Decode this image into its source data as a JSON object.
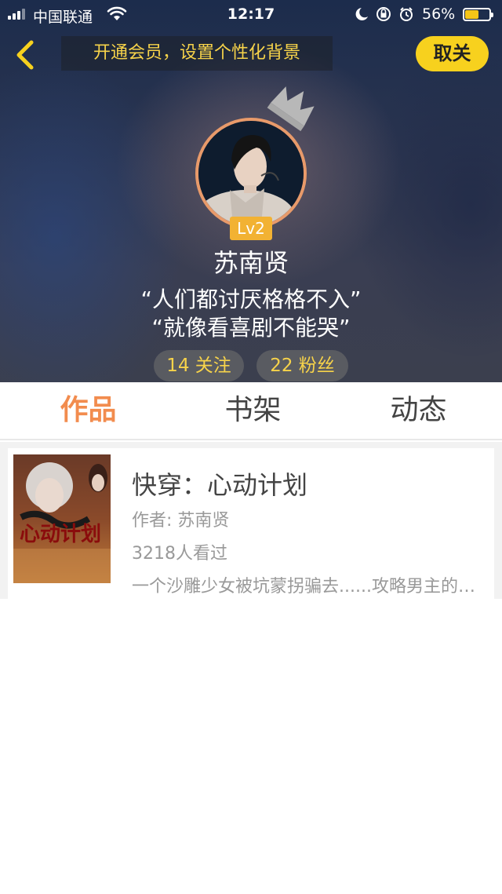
{
  "status_bar": {
    "carrier": "中国联通",
    "time": "12:17",
    "battery_percent": "56%",
    "battery_level": 0.56,
    "icons": [
      "signal-icon",
      "wifi-icon",
      "moon-icon",
      "rotation-lock-icon",
      "alarm-icon",
      "battery-icon"
    ]
  },
  "header": {
    "back_icon": "chevron-left-icon",
    "vip_banner": "开通会员，设置个性化背景",
    "close_label": "取关",
    "crown_icon": "crown-icon"
  },
  "profile": {
    "level": "Lv2",
    "username": "苏南贤",
    "bio_line1": "“人们都讨厌格格不入”",
    "bio_line2": "“就像看喜剧不能哭”",
    "following": "14 关注",
    "fans": "22 粉丝"
  },
  "tabs": [
    {
      "label": "作品",
      "active": true
    },
    {
      "label": "书架",
      "active": false
    },
    {
      "label": "动态",
      "active": false
    }
  ],
  "books": [
    {
      "title": "快穿：心动计划",
      "author": "作者: 苏南贤",
      "reads": "3218人看过",
      "description": "一个沙雕少女被坑蒙拐骗去......攻略男主的故事"
    }
  ],
  "colors": {
    "accent_orange": "#f28c4e",
    "accent_yellow": "#f7d11e",
    "banner_text": "#f7d34a",
    "level_badge": "#f2b233"
  }
}
